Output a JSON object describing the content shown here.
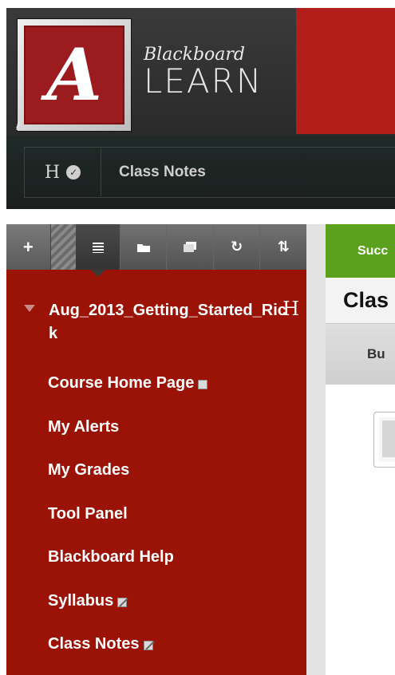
{
  "header": {
    "logo_letter": "A",
    "logo_corner": "ℓ",
    "brand_top": "Blackboard",
    "brand_bottom": "LEARN"
  },
  "breadcrumb": {
    "home_letter": "H",
    "check_glyph": "✓",
    "current": "Class Notes"
  },
  "sidebar": {
    "toolbar": {
      "add": "+",
      "refresh": "↻",
      "sort": "⇅"
    },
    "course_title": "Aug_2013_Getting_Started_Rick",
    "course_title_h": "H",
    "items": [
      {
        "label": "Course Home Page"
      },
      {
        "label": "My Alerts"
      },
      {
        "label": "My Grades"
      },
      {
        "label": "Tool Panel"
      },
      {
        "label": "Blackboard Help"
      },
      {
        "label": "Syllabus"
      },
      {
        "label": "Class Notes"
      }
    ]
  },
  "content": {
    "success_text": "Succ",
    "page_title": "Clas",
    "button_partial": "Bu"
  },
  "colors": {
    "sidebar_bg": "#9b1207",
    "header_red": "#b21e19",
    "success_green": "#5ca11d"
  }
}
